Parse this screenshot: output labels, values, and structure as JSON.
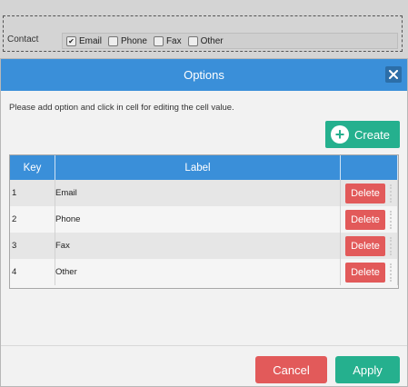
{
  "background_form": {
    "contact_label": "Contact",
    "options": [
      {
        "label": "Email",
        "checked": true
      },
      {
        "label": "Phone",
        "checked": false
      },
      {
        "label": "Fax",
        "checked": false
      },
      {
        "label": "Other",
        "checked": false
      }
    ]
  },
  "dialog": {
    "title": "Options",
    "close_icon": "close-icon",
    "instructions": "Please add option and click in cell for editing the cell value.",
    "create_label": "Create",
    "create_icon": "plus-circle-icon",
    "table": {
      "headers": [
        "Key",
        "Label",
        ""
      ],
      "rows": [
        {
          "key": "1",
          "label": "Email",
          "action": "Delete"
        },
        {
          "key": "2",
          "label": "Phone",
          "action": "Delete"
        },
        {
          "key": "3",
          "label": "Fax",
          "action": "Delete"
        },
        {
          "key": "4",
          "label": "Other",
          "action": "Delete"
        }
      ]
    },
    "cancel_label": "Cancel",
    "apply_label": "Apply"
  },
  "colors": {
    "header_blue": "#3a8fd9",
    "accent_green": "#25b08e",
    "danger_red": "#e25a5a"
  }
}
